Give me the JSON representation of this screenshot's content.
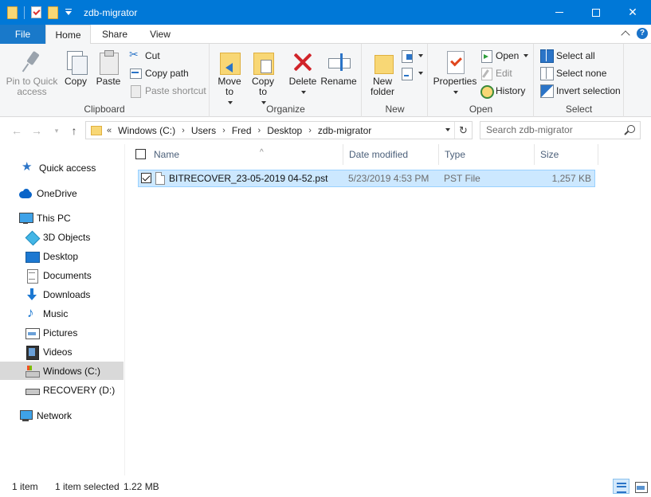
{
  "window": {
    "title": "zdb-migrator"
  },
  "ribbon_tabs": {
    "file": "File",
    "home": "Home",
    "share": "Share",
    "view": "View"
  },
  "clipboard": {
    "pin_label": "Pin to Quick access",
    "copy_label": "Copy",
    "paste_label": "Paste",
    "cut_label": "Cut",
    "copy_path_label": "Copy path",
    "paste_shortcut_label": "Paste shortcut",
    "group_label": "Clipboard"
  },
  "organize": {
    "move_to_label": "Move to",
    "copy_to_label": "Copy to",
    "delete_label": "Delete",
    "rename_label": "Rename",
    "group_label": "Organize"
  },
  "new_group": {
    "new_folder_label": "New folder",
    "group_label": "New"
  },
  "open_group": {
    "properties_label": "Properties",
    "open_label": "Open",
    "edit_label": "Edit",
    "history_label": "History",
    "group_label": "Open"
  },
  "select_group": {
    "select_all_label": "Select all",
    "select_none_label": "Select none",
    "invert_selection_label": "Invert selection",
    "group_label": "Select"
  },
  "address": {
    "overflow": "«",
    "crumbs": [
      "Windows (C:)",
      "Users",
      "Fred",
      "Desktop",
      "zdb-migrator"
    ]
  },
  "search": {
    "placeholder": "Search zdb-migrator"
  },
  "navigation_pane": {
    "quick_access": "Quick access",
    "onedrive": "OneDrive",
    "this_pc": "This PC",
    "objects_3d": "3D Objects",
    "desktop": "Desktop",
    "documents": "Documents",
    "downloads": "Downloads",
    "music": "Music",
    "pictures": "Pictures",
    "videos": "Videos",
    "windows_c": "Windows (C:)",
    "recovery_d": "RECOVERY (D:)",
    "network": "Network",
    "selected_item": "Windows (C:)"
  },
  "file_list": {
    "columns": {
      "name": "Name",
      "date_modified": "Date modified",
      "type": "Type",
      "size": "Size"
    },
    "rows": [
      {
        "name": "BITRECOVER_23-05-2019 04-52.pst",
        "date_modified": "5/23/2019 4:53 PM",
        "type": "PST File",
        "size": "1,257 KB",
        "selected": true
      }
    ]
  },
  "status_bar": {
    "item_count": "1 item",
    "selected_text": "1 item selected",
    "selected_size": "1.22 MB"
  },
  "colors": {
    "titlebar": "#0078d7",
    "file_tab": "#1979ca",
    "selection": "#cce8ff",
    "selection_border": "#99d1ff"
  }
}
